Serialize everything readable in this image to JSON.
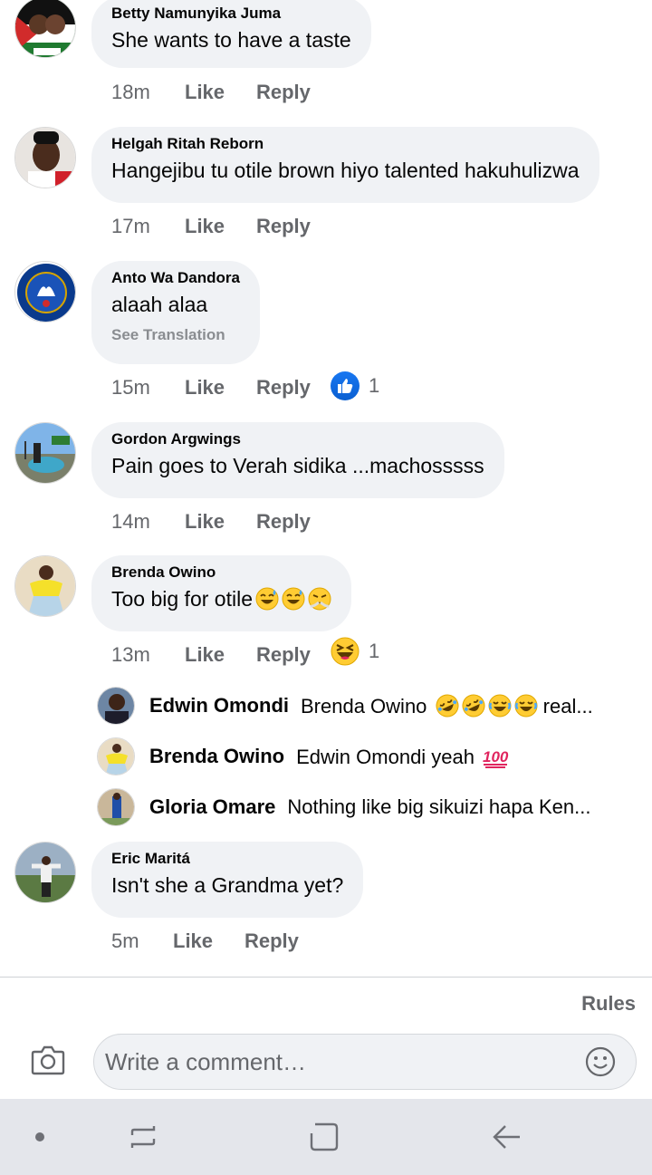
{
  "comments": [
    {
      "author": "Betty Namunyika Juma",
      "text": "She wants to have a taste",
      "time": "18m",
      "like": "Like",
      "reply": "Reply"
    },
    {
      "author": "Helgah Ritah Reborn",
      "text": "Hangejibu tu otile brown hiyo talented hakuhulizwa",
      "time": "17m",
      "like": "Like",
      "reply": "Reply"
    },
    {
      "author": "Anto Wa Dandora",
      "text": "alaah alaa",
      "see_translation": "See Translation",
      "time": "15m",
      "like": "Like",
      "reply": "Reply",
      "reaction": {
        "icon": "thumbs-up-icon",
        "count": "1"
      }
    },
    {
      "author": "Gordon Argwings",
      "text": "Pain goes to Verah sidika ...machosssss",
      "time": "14m",
      "like": "Like",
      "reply": "Reply"
    },
    {
      "author": "Brenda Owino",
      "text": "Too big for otile",
      "emojis": [
        "sweat-smile-emoji",
        "sweat-smile-emoji",
        "steam-nose-emoji"
      ],
      "time": "13m",
      "like": "Like",
      "reply": "Reply",
      "reaction": {
        "icon": "laughing-icon",
        "count": "1"
      }
    },
    {
      "author": "Eric Maritá",
      "text": "Isn't she a Grandma yet?",
      "time": "5m",
      "like": "Like",
      "reply": "Reply"
    }
  ],
  "replies": [
    {
      "author": "Edwin Omondi",
      "text_before": "Brenda Owino",
      "emojis": [
        "rofl-emoji",
        "rofl-emoji",
        "joy-emoji",
        "joy-emoji"
      ],
      "text_after": "real..."
    },
    {
      "author": "Brenda Owino",
      "text_before": "Edwin Omondi yeah",
      "emojis": [
        "hundred-points-emoji"
      ],
      "text_after": ""
    },
    {
      "author": "Gloria Omare",
      "text_before": "Nothing like big sikuizi hapa Ken...",
      "emojis": [],
      "text_after": ""
    }
  ],
  "footer": {
    "rules": "Rules",
    "comment_placeholder": "Write a comment…"
  },
  "colors": {
    "bubble": "#f0f2f5",
    "meta_text": "#65676b",
    "like_blue": "#1877f2",
    "navbar": "#e4e6eb"
  }
}
